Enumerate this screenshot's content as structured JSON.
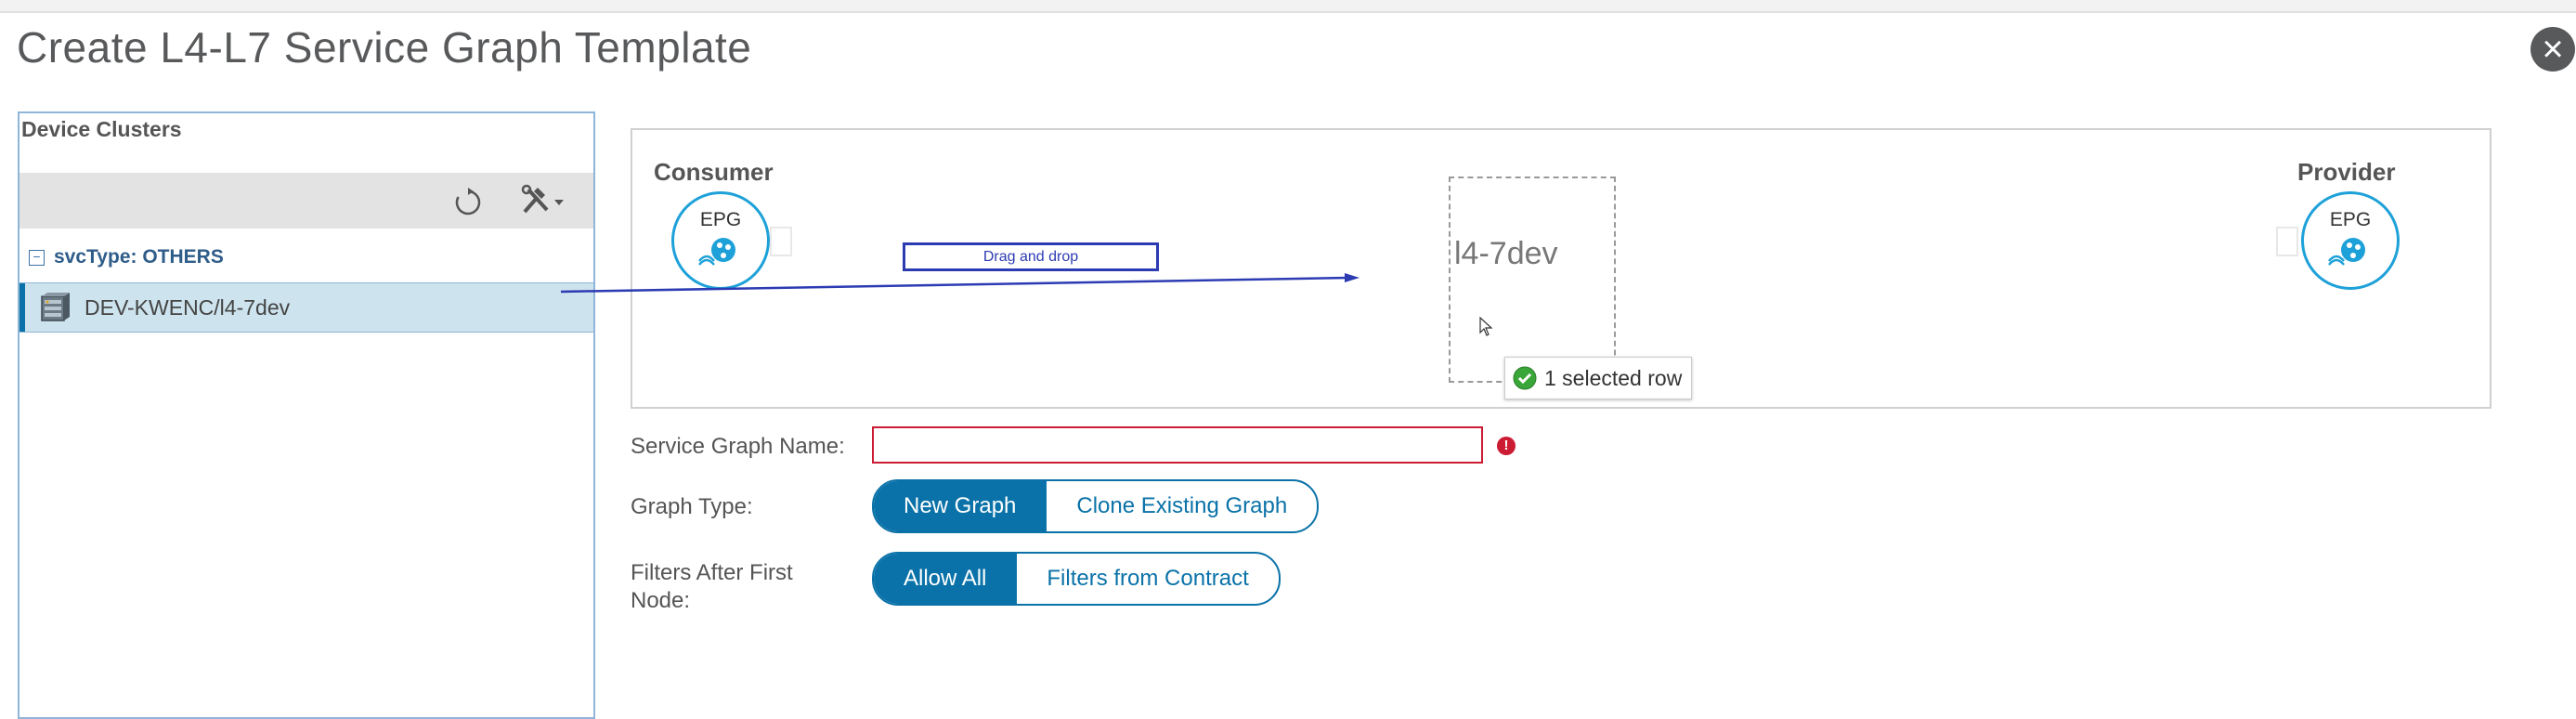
{
  "dialog": {
    "title": "Create L4-L7 Service Graph Template",
    "close_glyph": "×"
  },
  "device_clusters": {
    "header": "Device Clusters",
    "toolbar_icons": [
      "refresh-icon",
      "tools-dropdown-icon"
    ],
    "group": {
      "collapse_glyph": "−",
      "label": "svcType: OTHERS"
    },
    "items": [
      {
        "label": "DEV-KWENC/l4-7dev",
        "icon": "device-cluster-icon",
        "selected": true
      }
    ]
  },
  "canvas": {
    "consumer_label": "Consumer",
    "provider_label": "Provider",
    "epg_label": "EPG",
    "drag_hint": "Drag and drop",
    "node_label": "l4-7dev",
    "selected_tooltip": "1 selected row"
  },
  "form": {
    "service_graph_name_label": "Service Graph Name:",
    "service_graph_name_value": "",
    "error_glyph": "!",
    "graph_type_label": "Graph Type:",
    "graph_type_options": [
      "New Graph",
      "Clone Existing Graph"
    ],
    "graph_type_selected": "New Graph",
    "filters_label_line1": "Filters After First",
    "filters_label_line2": "Node:",
    "filters_options": [
      "Allow All",
      "Filters from Contract"
    ],
    "filters_selected": "Allow All"
  },
  "colors": {
    "accent": "#0a72a8",
    "epg_ring": "#1ea1d8",
    "error": "#cc1c34",
    "selection": "#cde3ed",
    "drag_line": "#2d3bb3"
  }
}
